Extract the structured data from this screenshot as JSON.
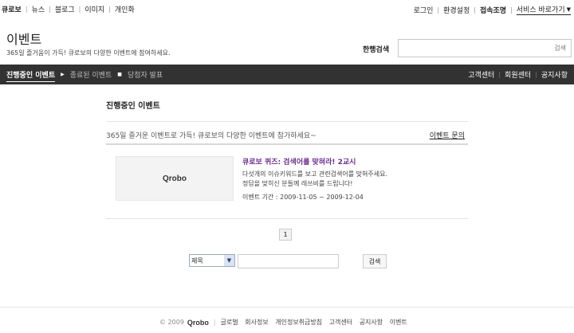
{
  "topnav": {
    "left": [
      "큐로보",
      "뉴스",
      "블로그",
      "이미지",
      "개인화"
    ],
    "right": [
      "로그인",
      "환경설정",
      "접속조명"
    ],
    "shortcut": "서비스 바로가기",
    "shortcut_icon": "chevron-down-icon"
  },
  "header": {
    "title": "이벤트",
    "subtitle": "365일 즐거움이 가득! 큐로보의 다양한 이벤트에 참여하세요.",
    "search_label": "한행검색",
    "search_placeholder": "검색"
  },
  "menubar": {
    "tabs": [
      "진행중인 이벤트",
      "종료된 이벤트",
      "당첨자 발표"
    ],
    "links": [
      "고객센터",
      "회원센터",
      "공지사항"
    ]
  },
  "main": {
    "section_title": "진행중인 이벤트",
    "intro": "365일 즐거운 이벤트로 가득! 큐로보의 다양한 이벤트에 참가하세요~",
    "inquiry_link": "이벤트 문의",
    "events": [
      {
        "thumbnail_text": "Qrobo",
        "title": "큐로보 퀴즈: 검색어를 맞혀라! 2교시",
        "desc_line1": "다섯개의 이슈키워드를 보고 관련검색어를 맞혀주세요.",
        "desc_line2": "정답을 맞히신 분들께 레쓰비를 드립니다!",
        "period": "이벤트 기간 : 2009-11-05 ~ 2009-12-04"
      }
    ]
  },
  "pagination": {
    "current_page": "1"
  },
  "search_bar": {
    "field_selected": "제목",
    "query": "",
    "button_label": "검색"
  },
  "footer": {
    "copyright": "© 2009",
    "brand": "Qrobo",
    "links": [
      "글로벌",
      "회사정보",
      "개인정보취급방침",
      "고객센터",
      "공지사항",
      "이벤트"
    ]
  }
}
